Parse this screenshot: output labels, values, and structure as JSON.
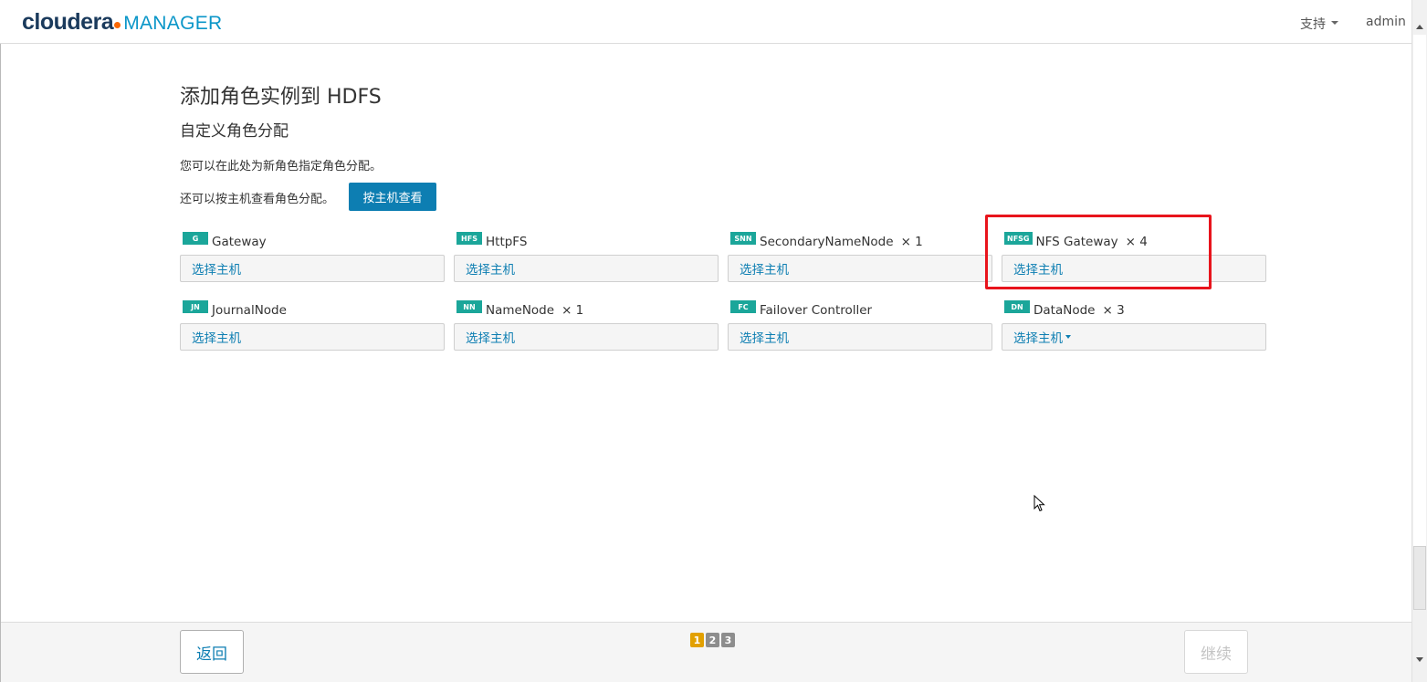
{
  "header": {
    "logo_word": "cloudera",
    "logo_product": "MANAGER",
    "support_label": "支持",
    "user_label": "admin"
  },
  "page": {
    "title": "添加角色实例到 HDFS",
    "subtitle": "自定义角色分配",
    "intro": "您可以在此处为新角色指定角色分配。",
    "view_by_host_text": "还可以按主机查看角色分配。",
    "view_by_host_button": "按主机查看"
  },
  "roles": [
    {
      "badge": "G",
      "name": "Gateway",
      "count": "",
      "host_placeholder": "选择主机"
    },
    {
      "badge": "HFS",
      "name": "HttpFS",
      "count": "",
      "host_placeholder": "选择主机"
    },
    {
      "badge": "SNN",
      "name": "SecondaryNameNode",
      "count": "× 1",
      "host_placeholder": "选择主机"
    },
    {
      "badge": "NFSG",
      "name": "NFS Gateway",
      "count": "× 4",
      "host_placeholder": "选择主机"
    },
    {
      "badge": "JN",
      "name": "JournalNode",
      "count": "",
      "host_placeholder": "选择主机"
    },
    {
      "badge": "NN",
      "name": "NameNode",
      "count": "× 1",
      "host_placeholder": "选择主机"
    },
    {
      "badge": "FC",
      "name": "Failover Controller",
      "count": "",
      "host_placeholder": "选择主机"
    },
    {
      "badge": "DN",
      "name": "DataNode",
      "count": "× 3",
      "host_placeholder": "选择主机"
    }
  ],
  "footer": {
    "back_label": "返回",
    "next_label": "继续",
    "steps": [
      "1",
      "2",
      "3"
    ],
    "active_step": "1"
  },
  "colors": {
    "accent": "#0d7eb2",
    "badge": "#1ba69a",
    "highlight": "#e8141c",
    "active_step": "#e2a000"
  }
}
